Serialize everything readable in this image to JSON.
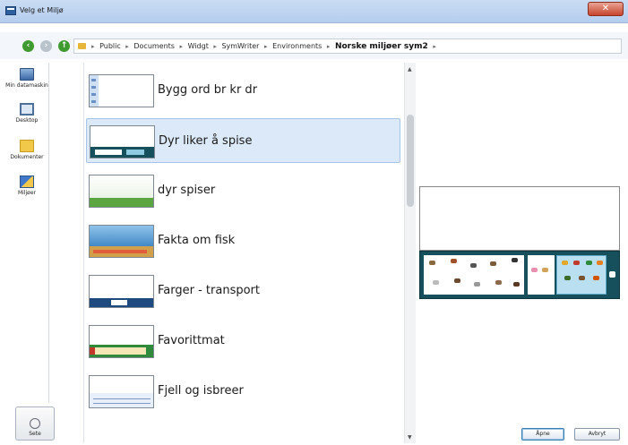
{
  "window": {
    "title": "Velg et Miljø",
    "close_label": "✕"
  },
  "nav": {
    "back_icon": "back-arrow-icon",
    "forward_icon": "forward-arrow-icon",
    "up_icon": "up-arrow-icon",
    "breadcrumbs": [
      "Public",
      "Documents",
      "Widgt",
      "SymWriter",
      "Environments",
      "Norske miljøer sym2"
    ]
  },
  "places": [
    {
      "label": "Min datamaskin",
      "icon": "computer-icon"
    },
    {
      "label": "Desktop",
      "icon": "desktop-icon"
    },
    {
      "label": "Dokumenter",
      "icon": "folder-icon"
    },
    {
      "label": "Miljøer",
      "icon": "environment-icon"
    }
  ],
  "settings": {
    "label": "Sete"
  },
  "files": [
    {
      "label": "Bygg ord br kr dr",
      "selected": false
    },
    {
      "label": "Dyr liker å spise",
      "selected": true
    },
    {
      "label": "dyr spiser",
      "selected": false
    },
    {
      "label": "Fakta om fisk",
      "selected": false
    },
    {
      "label": "Farger - transport",
      "selected": false
    },
    {
      "label": "Favorittmat",
      "selected": false
    },
    {
      "label": "Fjell og isbreer",
      "selected": false
    }
  ],
  "buttons": {
    "open": "Åpne",
    "cancel": "Avbryt"
  },
  "colors": {
    "selection": "#dce9f8",
    "preview_bg": "#15505c",
    "titlebar": "#b5cdee"
  }
}
